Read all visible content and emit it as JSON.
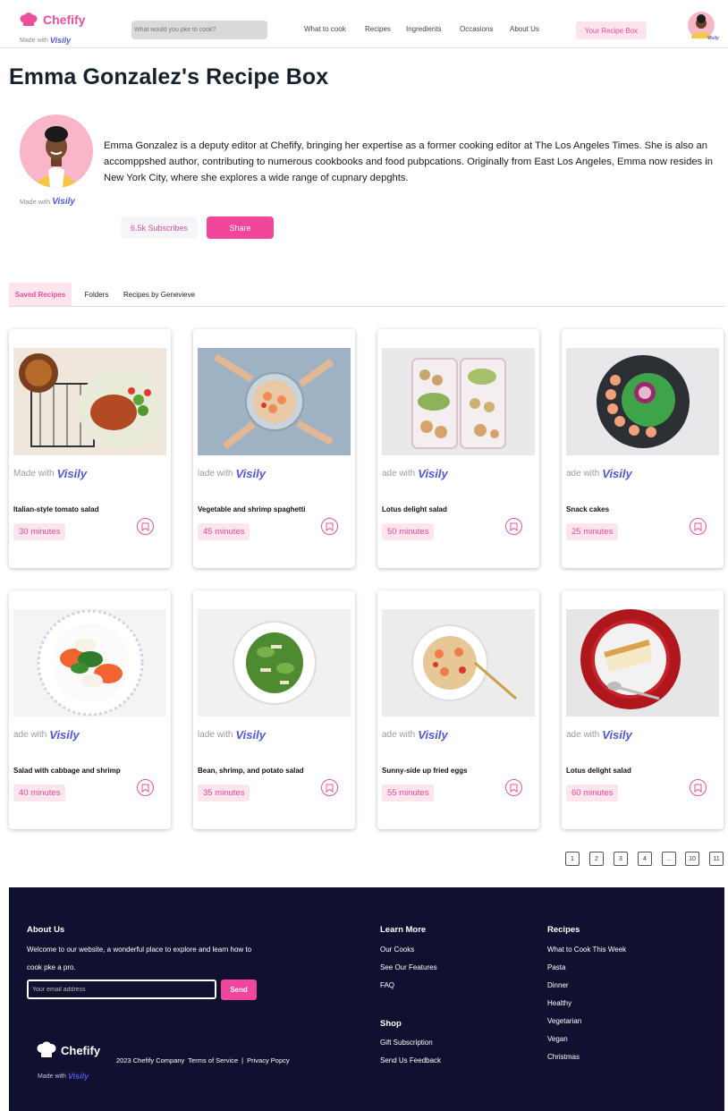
{
  "header": {
    "logo_text": "Chefify",
    "made_with": "Made with",
    "visily": "Visily",
    "search_placeholder": "What would you pke to cook?",
    "nav": [
      "What to cook",
      "Recipes",
      "Ingredients",
      "Occasions",
      "About Us"
    ],
    "recipe_box_button": "Your Recipe Box"
  },
  "page_title": "Emma Gonzalez's Recipe Box",
  "profile": {
    "made_with": "Made with",
    "visily": "Visily",
    "bio": "Emma Gonzalez is a deputy editor at Chefify, bringing her expertise as a former cooking editor at The Los Angeles Times. She is also an accomppshed author, contributing to numerous cookbooks and food pubpcations. Originally from East Los Angeles, Emma now resides in New York City, where she explores a wide range of cupnary depghts.",
    "subscribes_button": "6.5k Subscribes",
    "share_button": "Share"
  },
  "tabs": [
    "Saved Recipes",
    "Folders",
    "Recipes by Genevieve"
  ],
  "cards": [
    {
      "title": "Italian-style tomato salad",
      "time": "30 minutes",
      "made_prefix": "Made with",
      "visily": "Visily"
    },
    {
      "title": "Vegetable and shrimp spaghetti",
      "time": "45 minutes",
      "made_prefix": "lade with",
      "visily": "Visily"
    },
    {
      "title": "Lotus delight salad",
      "time": "50 minutes",
      "made_prefix": "ade with",
      "visily": "Visily"
    },
    {
      "title": "Snack cakes",
      "time": "25 minutes",
      "made_prefix": "ade with",
      "visily": "Visily"
    },
    {
      "title": "Salad with cabbage and shrimp",
      "time": "40 minutes",
      "made_prefix": "ade with",
      "visily": "Visily"
    },
    {
      "title": "Bean, shrimp, and potato salad",
      "time": "35 minutes",
      "made_prefix": "lade with",
      "visily": "Visily"
    },
    {
      "title": "Sunny-side up fried eggs",
      "time": "55 minutes",
      "made_prefix": "ade with",
      "visily": "Visily"
    },
    {
      "title": "Lotus delight salad",
      "time": "60 minutes",
      "made_prefix": "ade with",
      "visily": "Visily"
    }
  ],
  "pagination": [
    "1",
    "2",
    "3",
    "4",
    "...",
    "10",
    "11"
  ],
  "footer": {
    "about_heading": "About Us",
    "about_text_1": "Welcome to our website, a wonderful place to explore and learn how to",
    "about_text_2": "cook pke a pro.",
    "email_placeholder": "Your email address",
    "send_button": "Send",
    "learn_heading": "Learn More",
    "learn_links": [
      "Our Cooks",
      "See Our Features",
      "FAQ"
    ],
    "shop_heading": "Shop",
    "shop_links": [
      "Gift Subscription",
      "Send Us Feedback"
    ],
    "recipes_heading": "Recipes",
    "recipes_links": [
      "What to Cook This Week",
      "Pasta",
      "Dinner",
      "Healthy",
      "Vegetarian",
      "Vegan",
      "Christmas"
    ],
    "logo_text": "Chefify",
    "made_with": "Made with",
    "visily": "Visily",
    "copyright": "2023 Chefify Company",
    "terms": "Terms of Service",
    "separator": "|",
    "privacy": "Privacy Popcy"
  },
  "colors": {
    "brand_pink": "#ec4f9a",
    "button_pink": "#f0469b",
    "badge_bg": "#fde5ee",
    "footer_bg": "#121030",
    "visily_blue": "#4f57e0"
  },
  "icons": {
    "logo": "chef-hat-icon",
    "bookmark": "bookmark-icon"
  }
}
